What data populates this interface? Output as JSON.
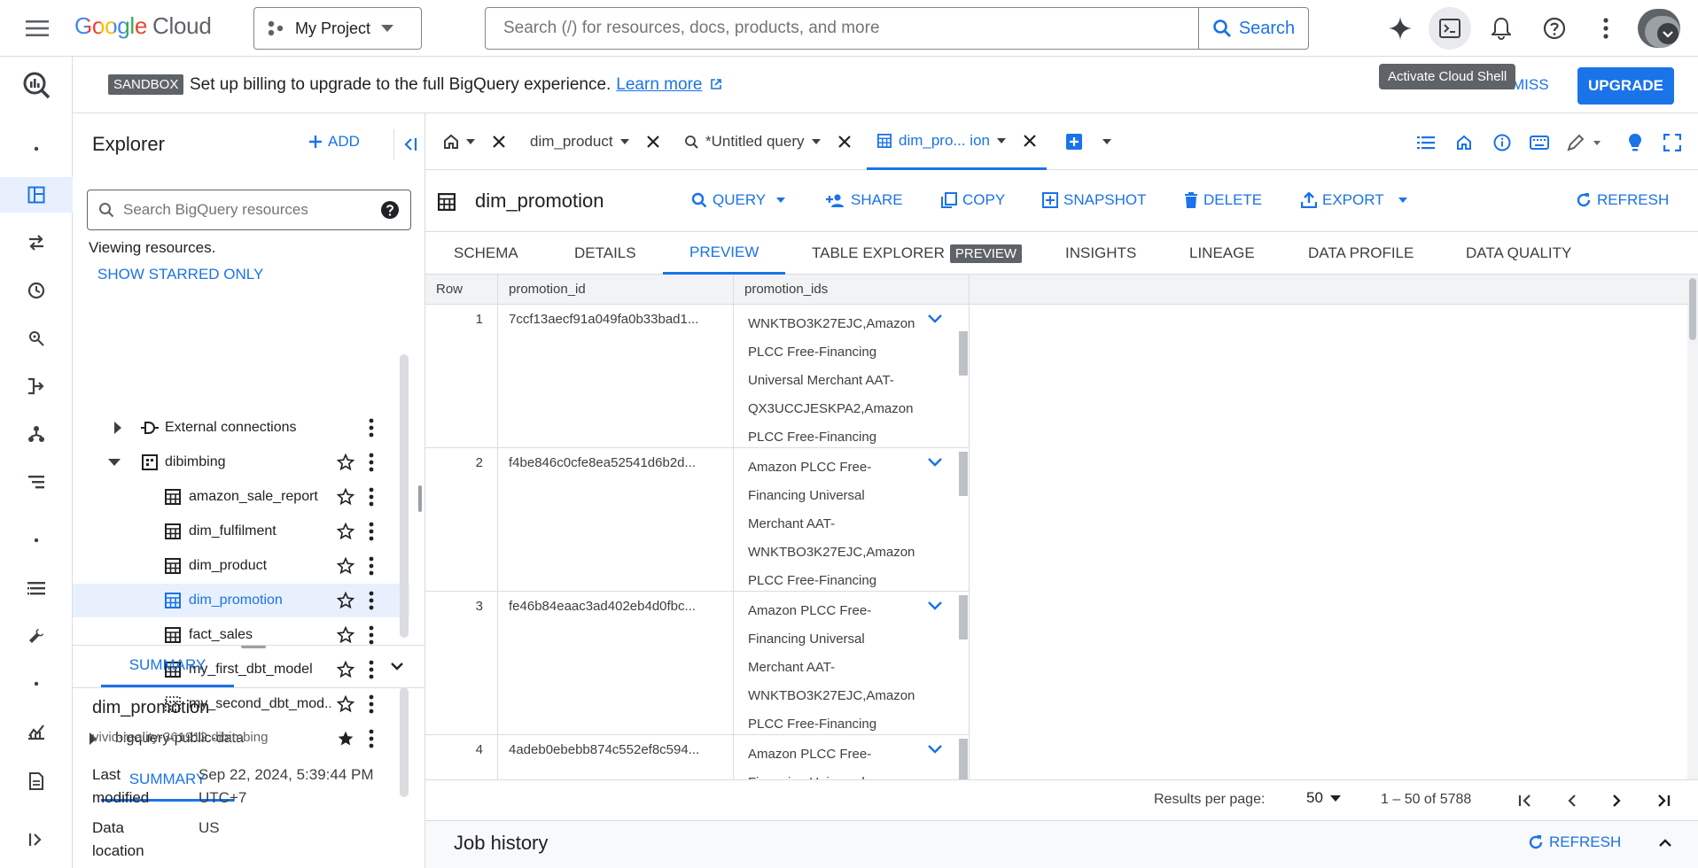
{
  "topbar": {
    "logo_google": "Google",
    "logo_cloud": "Cloud",
    "project": "My Project",
    "search_placeholder": "Search (/) for resources, docs, products, and more",
    "search_button": "Search"
  },
  "banner": {
    "badge": "SANDBOX",
    "text": "Set up billing to upgrade to the full BigQuery experience.",
    "link": "Learn more",
    "tooltip": "Activate Cloud Shell",
    "dismiss": "MISS",
    "upgrade": "UPGRADE"
  },
  "explorer": {
    "title": "Explorer",
    "add_label": "ADD",
    "search_placeholder": "Search BigQuery resources",
    "viewing": "Viewing resources.",
    "starred_toggle": "SHOW STARRED ONLY",
    "tree": [
      {
        "label": "External connections",
        "level": 1,
        "expander": "collapsed",
        "icon": "connection"
      },
      {
        "label": "dibimbing",
        "level": 1,
        "expander": "expanded",
        "icon": "dataset"
      },
      {
        "label": "amazon_sale_report",
        "level": 2,
        "icon": "table"
      },
      {
        "label": "dim_fulfilment",
        "level": 2,
        "icon": "table"
      },
      {
        "label": "dim_product",
        "level": 2,
        "icon": "table"
      },
      {
        "label": "dim_promotion",
        "level": 2,
        "icon": "table",
        "selected": true
      },
      {
        "label": "fact_sales",
        "level": 2,
        "icon": "table"
      },
      {
        "label": "my_first_dbt_model",
        "level": 2,
        "icon": "table"
      },
      {
        "label": "my_second_dbt_mod...",
        "level": 2,
        "icon": "view"
      },
      {
        "label": "bigquery-public-data",
        "level": 0,
        "expander": "collapsed",
        "starred": true
      }
    ]
  },
  "summary": {
    "tab": "SUMMARY",
    "name": "dim_promotion",
    "path": "vivid-reality-361912.dibimbing",
    "last_modified_label": "Last modified",
    "last_modified_value": "Sep 22, 2024, 5:39:44 PM UTC+7",
    "location_label": "Data location",
    "location_value": "US"
  },
  "tabs": {
    "home_tab": "",
    "items": [
      "dim_product",
      "*Untitled query",
      "dim_pro... ion"
    ]
  },
  "table": {
    "title": "dim_promotion",
    "actions": [
      "QUERY",
      "SHARE",
      "COPY",
      "SNAPSHOT",
      "DELETE",
      "EXPORT"
    ],
    "refresh": "REFRESH",
    "subtabs": [
      "SCHEMA",
      "DETAILS",
      "PREVIEW",
      "TABLE EXPLORER",
      "INSIGHTS",
      "LINEAGE",
      "DATA PROFILE",
      "DATA QUALITY"
    ],
    "preview_chip": "PREVIEW",
    "columns": [
      "Row",
      "promotion_id",
      "promotion_ids"
    ],
    "rows": [
      {
        "row": "1",
        "promotion_id": "7ccf13aecf91a049fa0b33bad1...",
        "promotion_ids": [
          "WNKTBO3K27EJC,Amazon",
          "PLCC Free-Financing",
          "Universal Merchant AAT-",
          "QX3UCCJESKPA2,Amazon",
          "PLCC Free-Financing"
        ]
      },
      {
        "row": "2",
        "promotion_id": "f4be846c0cfe8ea52541d6b2d...",
        "promotion_ids": [
          "Amazon PLCC Free-",
          "Financing Universal",
          "Merchant AAT-",
          "WNKTBO3K27EJC,Amazon",
          "PLCC Free-Financing"
        ]
      },
      {
        "row": "3",
        "promotion_id": "fe46b84eaac3ad402eb4d0fbc...",
        "promotion_ids": [
          "Amazon PLCC Free-",
          "Financing Universal",
          "Merchant AAT-",
          "WNKTBO3K27EJC,Amazon",
          "PLCC Free-Financing"
        ]
      },
      {
        "row": "4",
        "promotion_id": "4adeb0ebebb874c552ef8c594...",
        "promotion_ids": [
          "Amazon PLCC Free-",
          "Financing Universal"
        ]
      }
    ]
  },
  "pagination": {
    "label": "Results per page:",
    "per_page": "50",
    "range": "1 – 50 of 5788"
  },
  "job_history": {
    "title": "Job history",
    "refresh": "REFRESH"
  },
  "colors": {
    "accent": "#1a73e8",
    "badge": "#5f6368",
    "selected_bg": "#e8f0fe"
  }
}
